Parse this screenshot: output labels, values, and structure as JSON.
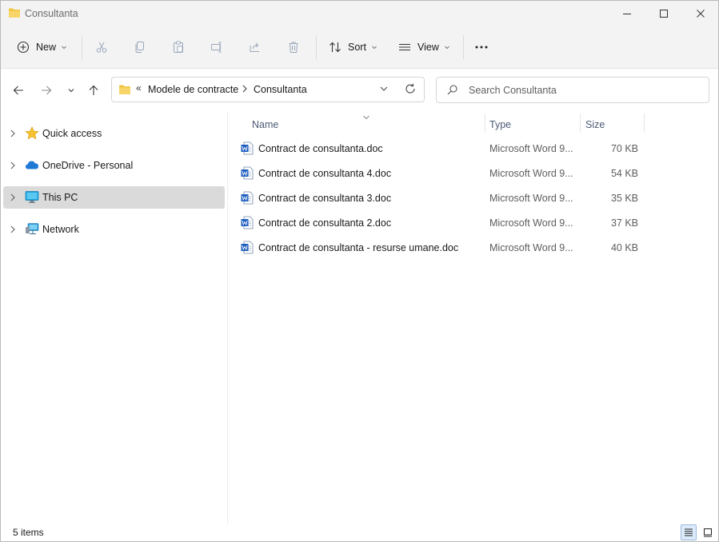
{
  "window": {
    "title": "Consultanta",
    "controls": {
      "minimize": "minimize",
      "maximize": "maximize",
      "close": "close"
    }
  },
  "toolbar": {
    "new_label": "New",
    "sort_label": "Sort",
    "view_label": "View",
    "more_label": "···",
    "icons": [
      "add-icon",
      "cut-icon",
      "copy-icon",
      "paste-icon",
      "rename-icon",
      "share-icon",
      "delete-icon",
      "sort-icon",
      "view-icon",
      "more-icon"
    ]
  },
  "address": {
    "overflow": "«",
    "path": [
      "Modele de contracte",
      "Consultanta"
    ],
    "separator": "›"
  },
  "search": {
    "placeholder": "Search Consultanta"
  },
  "nav": {
    "items": [
      {
        "label": "Quick access",
        "icon": "star-icon",
        "selected": false
      },
      {
        "label": "OneDrive - Personal",
        "icon": "cloud-icon",
        "selected": false
      },
      {
        "label": "This PC",
        "icon": "monitor-icon",
        "selected": true
      },
      {
        "label": "Network",
        "icon": "network-icon",
        "selected": false
      }
    ]
  },
  "columns": {
    "name": "Name",
    "type": "Type",
    "size": "Size"
  },
  "files": [
    {
      "name": "Contract de consultanta.doc",
      "type": "Microsoft Word 9...",
      "size": "70 KB"
    },
    {
      "name": "Contract de consultanta 4.doc",
      "type": "Microsoft Word 9...",
      "size": "54 KB"
    },
    {
      "name": "Contract de consultanta 3.doc",
      "type": "Microsoft Word 9...",
      "size": "35 KB"
    },
    {
      "name": "Contract de consultanta 2.doc",
      "type": "Microsoft Word 9...",
      "size": "37 KB"
    },
    {
      "name": "Contract de consultanta - resurse umane.doc",
      "type": "Microsoft Word 9...",
      "size": "40 KB"
    }
  ],
  "status": {
    "count": "5 items"
  },
  "colors": {
    "accent": "#0067c0",
    "folder": "#f0c33c",
    "selection": "#dadada",
    "word_blue": "#1f5fbf"
  }
}
